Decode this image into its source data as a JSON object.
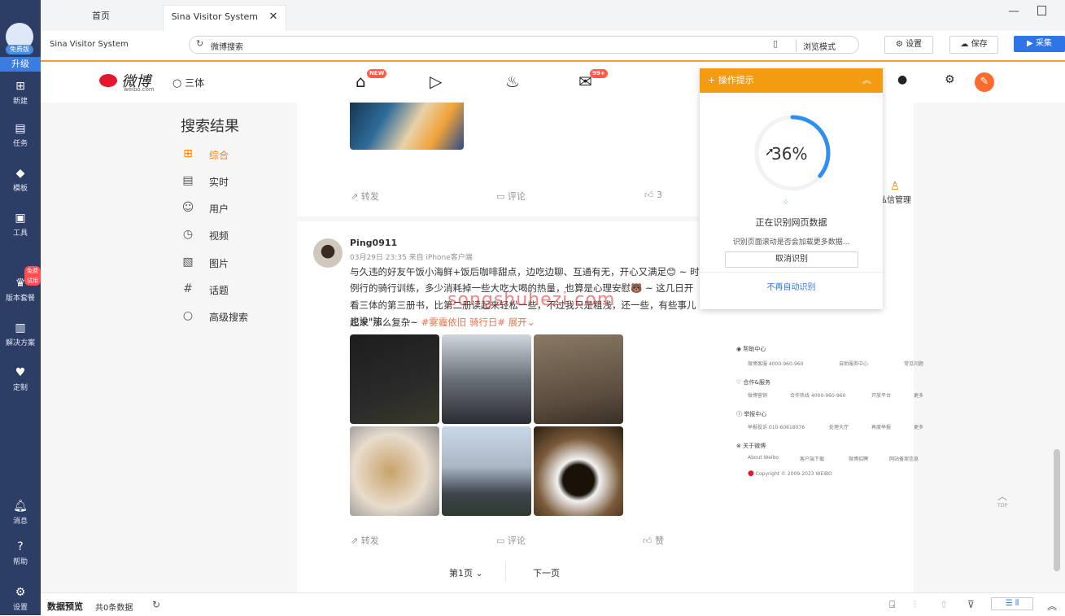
{
  "app": {
    "plan_badge": "免费版",
    "upgrade": "升级",
    "trial_badge": "免费试用",
    "sidebar": [
      {
        "label": "新建",
        "icon": "plus-icon"
      },
      {
        "label": "任务",
        "icon": "bookmark-icon"
      },
      {
        "label": "模板",
        "icon": "template-icon"
      },
      {
        "label": "工具",
        "icon": "toolbox-icon"
      },
      {
        "label": "版本套餐",
        "icon": "crown-icon"
      },
      {
        "label": "解决方案",
        "icon": "chart-icon"
      },
      {
        "label": "定制",
        "icon": "heart-check-icon"
      },
      {
        "label": "消息",
        "icon": "bell-icon"
      },
      {
        "label": "帮助",
        "icon": "help-icon"
      },
      {
        "label": "设置",
        "icon": "gear-icon"
      }
    ],
    "accent": "#f39c12",
    "sidebar_color": "#2c3e66"
  },
  "tabs": [
    {
      "label": "首页"
    },
    {
      "label": "Sina Visitor System"
    }
  ],
  "toolbar": {
    "page_title": "Sina Visitor System",
    "address": "微博搜索",
    "browse_mode": "浏览模式",
    "settings": "设置",
    "save": "保存",
    "collect": "采集"
  },
  "weibo": {
    "logo_text": "微博",
    "logo_sub": "weibo.com",
    "search_query": "三体",
    "new_badge": "NEW",
    "msg_badge": "99+",
    "search_results_title": "搜索结果",
    "left_nav": [
      {
        "label": "综合",
        "icon": "grid-icon"
      },
      {
        "label": "实时",
        "icon": "news-icon"
      },
      {
        "label": "用户",
        "icon": "users-icon"
      },
      {
        "label": "视频",
        "icon": "play-icon"
      },
      {
        "label": "图片",
        "icon": "image-icon"
      },
      {
        "label": "话题",
        "icon": "hashtag-icon"
      },
      {
        "label": "高级搜索",
        "icon": "search-icon"
      }
    ],
    "post1_actions": {
      "repost": "转发",
      "comment": "评论",
      "like": "3"
    },
    "post2": {
      "user": "Ping0911",
      "meta": "03月29日 23:35  来自 iPhone客户端",
      "lines": [
        "与久违的好友午饭小海鲜+饭后咖啡甜点，边吃边聊、互通有无，开心又满足😊 ~ 时",
        "例行的骑行训练，多少消耗掉一些大吃大喝的热量，也算是心理安慰🐻 ~ 这几日开",
        "看三体的第三册书，比第二册读起来轻松一些，不过我只是粗浅，还一些，有些事儿也没\"法",
        "起来\"那么复杂~ "
      ],
      "tags": "#雾霾依旧 骑行日#",
      "expand": "展开",
      "actions": {
        "repost": "转发",
        "comment": "评论",
        "like": "赞"
      }
    },
    "pagination": {
      "current": "第1页",
      "next": "下一页"
    },
    "right": {
      "msg_manage": "私信管理",
      "footer": [
        {
          "title": "帮助中心",
          "items": [
            "微博客服 4000-960-960",
            "自助服务中心",
            "常见问题"
          ]
        },
        {
          "title": "合作&服务",
          "items": [
            "微博营销",
            "合作热线 4000-960-960",
            "开放平台",
            "更多"
          ]
        },
        {
          "title": "举报中心",
          "items": [
            "举报投诉 010-60618076",
            "处理大厅",
            "再度举报",
            "更多"
          ]
        },
        {
          "title": "关于微博",
          "items": [
            "About Weibo",
            "客户端下载",
            "微博招聘",
            "网站备案信息"
          ]
        }
      ],
      "copyright": "Copyright © 2009-2023 WEIBO",
      "top": "TOP"
    },
    "watermark": "songshuhezi.com"
  },
  "popup": {
    "title": "操作提示",
    "progress_label": "36%",
    "progress": 0.36,
    "status": "正在识别网页数据",
    "hint": "识别页面滚动是否会加载更多数据...",
    "cancel": "取消识别",
    "disable": "不再自动识别"
  },
  "bottom": {
    "preview": "数据预览",
    "count": "共0条数据"
  }
}
